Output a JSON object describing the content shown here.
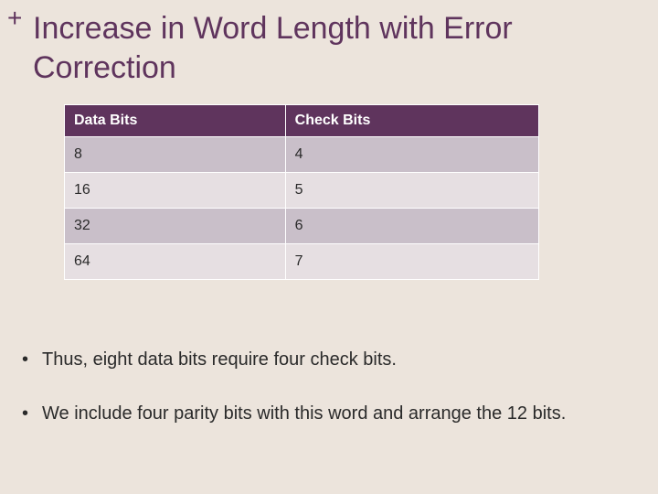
{
  "plus_symbol": "+",
  "title": "Increase in Word Length with Error Correction",
  "chart_data": {
    "type": "table",
    "columns": [
      "Data Bits",
      "Check Bits"
    ],
    "rows": [
      {
        "data_bits": "8",
        "check_bits": "4"
      },
      {
        "data_bits": "16",
        "check_bits": "5"
      },
      {
        "data_bits": "32",
        "check_bits": "6"
      },
      {
        "data_bits": "64",
        "check_bits": "7"
      }
    ]
  },
  "bullets": [
    "Thus, eight data bits require four check bits.",
    "We include four parity bits with this word and arrange the 12 bits."
  ]
}
